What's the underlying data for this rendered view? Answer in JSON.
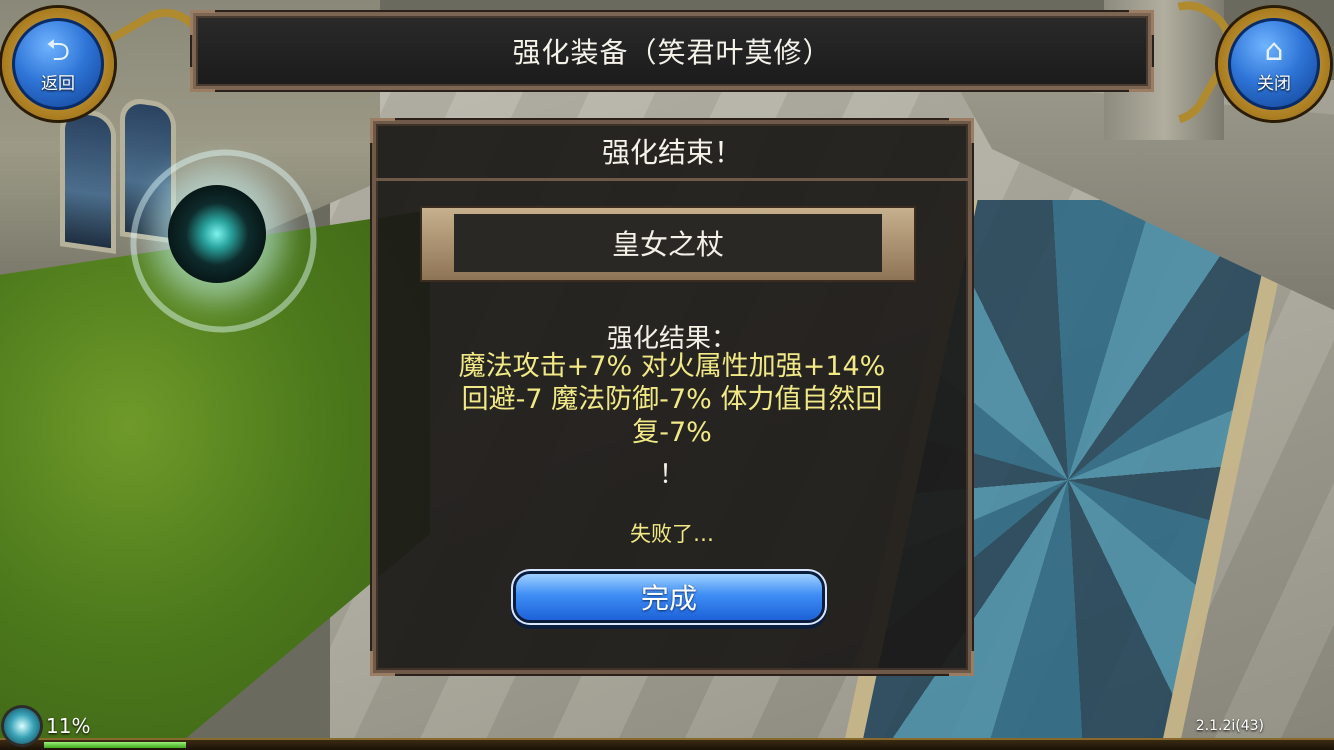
{
  "header": {
    "title": "强化装备（笑君叶莫修）",
    "back_label": "返回",
    "back_icon": "back-arrow-icon",
    "close_label": "关闭",
    "close_icon": "home-icon"
  },
  "dialog": {
    "heading": "强化结束！",
    "item_name": "皇女之杖",
    "result_label": "强化结果：",
    "result_lines": [
      "魔法攻击+7% 对火属性加强+14%",
      "回避-7 魔法防御-7% 体力值自然回",
      "复-7%"
    ],
    "exclaim": "！",
    "fail_text": "失败了…",
    "done_label": "完成"
  },
  "hud": {
    "progress_percent": 11,
    "progress_label": "11%",
    "version": "2.1.2i(43)"
  },
  "colors": {
    "accent_yellow": "#f1e985",
    "button_blue": "#3f8ef5",
    "frame_brown": "#6f5a4a"
  }
}
